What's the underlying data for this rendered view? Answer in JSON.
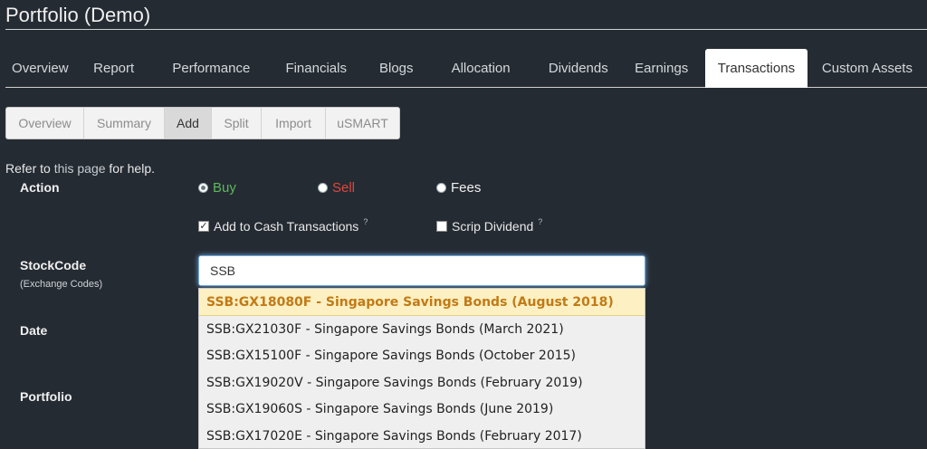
{
  "page": {
    "title": "Portfolio (Demo)"
  },
  "main_tabs": [
    {
      "label": "Overview",
      "active": false
    },
    {
      "label": "Report",
      "active": false
    },
    {
      "label": "Performance",
      "active": false
    },
    {
      "label": "Financials",
      "active": false
    },
    {
      "label": "Blogs",
      "active": false
    },
    {
      "label": "Allocation",
      "active": false
    },
    {
      "label": "Dividends",
      "active": false
    },
    {
      "label": "Earnings",
      "active": false
    },
    {
      "label": "Transactions",
      "active": true
    },
    {
      "label": "Custom Assets",
      "active": false
    }
  ],
  "sub_tabs": [
    {
      "label": "Overview",
      "active": false
    },
    {
      "label": "Summary",
      "active": false
    },
    {
      "label": "Add",
      "active": true
    },
    {
      "label": "Split",
      "active": false
    },
    {
      "label": "Import",
      "active": false
    },
    {
      "label": "uSMART",
      "active": false
    }
  ],
  "help": {
    "prefix": "Refer to ",
    "link": "this page",
    "suffix": " for help."
  },
  "form": {
    "action_label": "Action",
    "actions": [
      {
        "label": "Buy",
        "color": "#5cb85c",
        "checked": true
      },
      {
        "label": "Sell",
        "color": "#e0473d",
        "checked": false
      },
      {
        "label": "Fees",
        "color": "#f0f0f0",
        "checked": false
      }
    ],
    "add_to_cash": {
      "label": "Add to Cash Transactions",
      "hint": "?",
      "checked": true
    },
    "scrip_dividend": {
      "label": "Scrip Dividend",
      "hint": "?",
      "checked": false
    },
    "stockcode_label": "StockCode",
    "exchange_codes_open": "(",
    "exchange_codes_link": "Exchange Codes",
    "exchange_codes_close": ")",
    "stockcode_value": "SSB",
    "date_label": "Date",
    "portfolio_label": "Portfolio"
  },
  "suggestions": [
    "SSB:GX18080F - Singapore Savings Bonds (August 2018)",
    "SSB:GX21030F - Singapore Savings Bonds (March 2021)",
    "SSB:GX15100F - Singapore Savings Bonds (October 2015)",
    "SSB:GX19020V - Singapore Savings Bonds (February 2019)",
    "SSB:GX19060S - Singapore Savings Bonds (June 2019)",
    "SSB:GX17020E - Singapore Savings Bonds (February 2017)"
  ],
  "colors": {
    "background": "#252b33",
    "highlight_text": "#c27a16",
    "focus": "#6fa8dc"
  }
}
